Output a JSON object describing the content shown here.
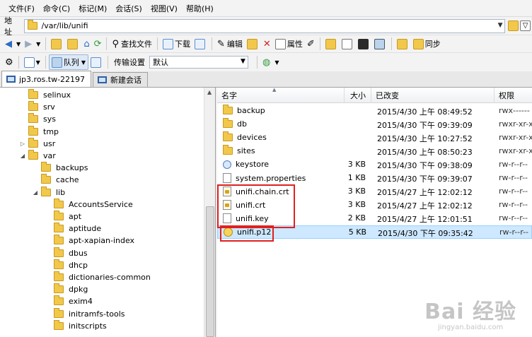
{
  "menu": [
    "文件(F)",
    "命令(C)",
    "标记(M)",
    "会话(S)",
    "视图(V)",
    "帮助(H)"
  ],
  "address": {
    "label": "地址",
    "path": "/var/lib/unifi"
  },
  "toolbar1": {
    "find_files": "查找文件",
    "download": "下载",
    "edit": "编辑",
    "properties": "属性",
    "sync": "同步"
  },
  "toolbar2": {
    "queue": "队列",
    "transfer_settings_label": "传输设置",
    "transfer_settings_value": "默认"
  },
  "tabs": [
    {
      "label": "jp3.ros.tw-22197"
    },
    {
      "label": "新建会话"
    }
  ],
  "tree": [
    {
      "label": "selinux",
      "expander": ""
    },
    {
      "label": "srv",
      "expander": ""
    },
    {
      "label": "sys",
      "expander": ""
    },
    {
      "label": "tmp",
      "expander": ""
    },
    {
      "label": "usr",
      "expander": "▷"
    },
    {
      "label": "var",
      "expander": "◢"
    },
    {
      "label": "backups",
      "expander": ""
    },
    {
      "label": "cache",
      "expander": ""
    },
    {
      "label": "lib",
      "expander": "◢"
    },
    {
      "label": "AccountsService",
      "expander": ""
    },
    {
      "label": "apt",
      "expander": ""
    },
    {
      "label": "aptitude",
      "expander": ""
    },
    {
      "label": "apt-xapian-index",
      "expander": ""
    },
    {
      "label": "dbus",
      "expander": ""
    },
    {
      "label": "dhcp",
      "expander": ""
    },
    {
      "label": "dictionaries-common",
      "expander": ""
    },
    {
      "label": "dpkg",
      "expander": ""
    },
    {
      "label": "exim4",
      "expander": ""
    },
    {
      "label": "initramfs-tools",
      "expander": ""
    },
    {
      "label": "initscripts",
      "expander": ""
    }
  ],
  "columns": {
    "name": "名字",
    "size": "大小",
    "modified": "已改变",
    "perms": "权限"
  },
  "files": [
    {
      "name": "backup",
      "size": "",
      "modified": "2015/4/30 上午 08:49:52",
      "perms": "rwx------",
      "icon": "folder-icon"
    },
    {
      "name": "db",
      "size": "",
      "modified": "2015/4/30 下午 09:39:09",
      "perms": "rwxr-xr-x",
      "icon": "folder-icon"
    },
    {
      "name": "devices",
      "size": "",
      "modified": "2015/4/30 上午 10:27:52",
      "perms": "rwxr-xr-x",
      "icon": "folder-icon"
    },
    {
      "name": "sites",
      "size": "",
      "modified": "2015/4/30 上午 08:50:23",
      "perms": "rwxr-xr-x",
      "icon": "folder-icon"
    },
    {
      "name": "keystore",
      "size": "3 KB",
      "modified": "2015/4/30 下午 09:38:09",
      "perms": "rw-r--r--",
      "icon": "keystore-icon"
    },
    {
      "name": "system.properties",
      "size": "1 KB",
      "modified": "2015/4/30 下午 09:39:07",
      "perms": "rw-r--r--",
      "icon": "file-icon"
    },
    {
      "name": "unifi.chain.crt",
      "size": "3 KB",
      "modified": "2015/4/27 上午 12:02:12",
      "perms": "rw-r--r--",
      "icon": "certificate-icon"
    },
    {
      "name": "unifi.crt",
      "size": "3 KB",
      "modified": "2015/4/27 上午 12:02:12",
      "perms": "rw-r--r--",
      "icon": "certificate-icon"
    },
    {
      "name": "unifi.key",
      "size": "2 KB",
      "modified": "2015/4/27 上午 12:01:51",
      "perms": "rw-r--r--",
      "icon": "file-icon"
    },
    {
      "name": "unifi.p12",
      "size": "5 KB",
      "modified": "2015/4/30 下午 09:35:42",
      "perms": "rw-r--r--",
      "icon": "pkcs12-icon"
    }
  ],
  "watermark": {
    "main": "Bai 经验",
    "sub": "jingyan.baidu.com"
  },
  "colors": {
    "highlight_box": "#e02020",
    "selection": "#cde8ff",
    "folder": "#f2c84b"
  }
}
